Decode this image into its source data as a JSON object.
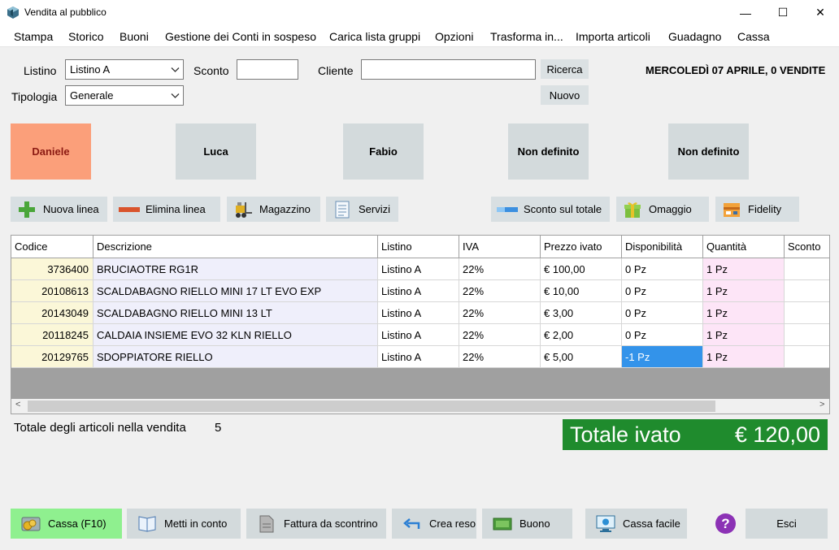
{
  "window": {
    "title": "Vendita al pubblico",
    "minimize_glyph": "—",
    "maximize_glyph": "☐",
    "close_glyph": "✕"
  },
  "menu": [
    "Stampa",
    "Storico",
    "Buoni",
    "Gestione dei Conti in sospeso",
    "Carica lista gruppi",
    "Opzioni",
    "Trasforma in...",
    "Importa articoli",
    "Guadagno",
    "Cassa"
  ],
  "form": {
    "listino_label": "Listino",
    "listino_value": "Listino A",
    "sconto_label": "Sconto",
    "sconto_value": "",
    "cliente_label": "Cliente",
    "cliente_value": "",
    "ricerca_button": "Ricerca",
    "nuovo_button": "Nuovo",
    "tipologia_label": "Tipologia",
    "tipologia_value": "Generale"
  },
  "date_header": "MERCOLEDÌ 07 APRILE, 0 VENDITE",
  "operators": [
    {
      "name": "Daniele",
      "active": true
    },
    {
      "name": "Luca",
      "active": false
    },
    {
      "name": "Fabio",
      "active": false
    },
    {
      "name": "Non definito",
      "active": false
    },
    {
      "name": "Non definito",
      "active": false
    }
  ],
  "toolbar": {
    "nuova_linea": "Nuova linea",
    "elimina_linea": "Elimina linea",
    "magazzino": "Magazzino",
    "servizi": "Servizi",
    "sconto_totale": "Sconto sul totale",
    "omaggio": "Omaggio",
    "fidelity": "Fidelity"
  },
  "table": {
    "columns": [
      "Codice",
      "Descrizione",
      "Listino",
      "IVA",
      "Prezzo ivato",
      "Disponibilità",
      "Quantità",
      "Sconto"
    ],
    "rows": [
      [
        "3736400",
        "BRUCIAOTRE RG1R",
        "Listino A",
        "22%",
        "€ 100,00",
        "0 Pz",
        "1 Pz",
        ""
      ],
      [
        "20108613",
        "SCALDABAGNO RIELLO MINI 17 LT EVO EXP",
        "Listino A",
        "22%",
        "€ 10,00",
        "0 Pz",
        "1 Pz",
        ""
      ],
      [
        "20143049",
        "SCALDABAGNO RIELLO MINI 13 LT",
        "Listino A",
        "22%",
        "€ 3,00",
        "0 Pz",
        "1 Pz",
        ""
      ],
      [
        "20118245",
        "CALDAIA INSIEME EVO 32 KLN RIELLO",
        "Listino A",
        "22%",
        "€ 2,00",
        "0 Pz",
        "1 Pz",
        ""
      ],
      [
        "20129765",
        "SDOPPIATORE RIELLO",
        "Listino A",
        "22%",
        "€ 5,00",
        "-1 Pz",
        "1 Pz",
        ""
      ]
    ],
    "scroll_left_glyph": "<",
    "scroll_right_glyph": ">"
  },
  "totals": {
    "count_label": "Totale degli articoli nella vendita",
    "count_value": "5",
    "total_label": "Totale ivato",
    "total_value": "€ 120,00"
  },
  "bottom": {
    "cassa": "Cassa (F10)",
    "metti_in_conto": "Metti in conto",
    "fattura": "Fattura da scontrino",
    "crea_reso": "Crea reso",
    "buono": "Buono",
    "cassa_facile": "Cassa facile",
    "help_glyph": "?",
    "esci": "Esci"
  },
  "colors": {
    "active_operator": "#fb9f7a",
    "total_bg": "#1f8b2d",
    "cassa_bg": "#8ff08f",
    "selected_cell": "#3393ea"
  }
}
